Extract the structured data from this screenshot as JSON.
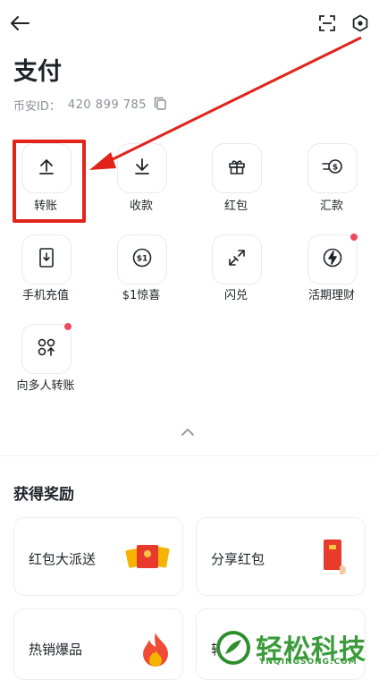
{
  "header": {
    "back_icon": "arrow-left-icon",
    "scan_icon": "scan-icon",
    "settings_icon": "hexagon-settings-icon"
  },
  "page": {
    "title": "支付",
    "uid_label": "币安ID：",
    "uid_value": "420 899 785",
    "copy_icon": "copy-icon"
  },
  "actions": [
    {
      "label": "转账",
      "icon": "upload-arrow-icon"
    },
    {
      "label": "收款",
      "icon": "download-arrow-icon"
    },
    {
      "label": "红包",
      "icon": "gift-icon"
    },
    {
      "label": "汇款",
      "icon": "remittance-icon"
    },
    {
      "label": "手机充值",
      "icon": "phone-topup-icon"
    },
    {
      "label": "$1惊喜",
      "icon": "dollar-coin-icon"
    },
    {
      "label": "闪兑",
      "icon": "swap-icon"
    },
    {
      "label": "活期理财",
      "icon": "lightning-coin-icon"
    },
    {
      "label": "向多人转账",
      "icon": "multi-transfer-icon"
    }
  ],
  "collapse_icon": "chevron-up-icon",
  "rewards": {
    "title": "获得奖励",
    "cards": [
      {
        "label": "红包大派送"
      },
      {
        "label": "分享红包"
      },
      {
        "label": "热销爆品"
      },
      {
        "label": "转"
      }
    ]
  },
  "watermark": {
    "text": "轻松科技",
    "sub": "YNQINGSONG.COM"
  },
  "colors": {
    "annotation": "#e2231a",
    "badge": "#ef4b60",
    "primary_text": "#1e2329",
    "secondary_text": "#8a8f98"
  }
}
